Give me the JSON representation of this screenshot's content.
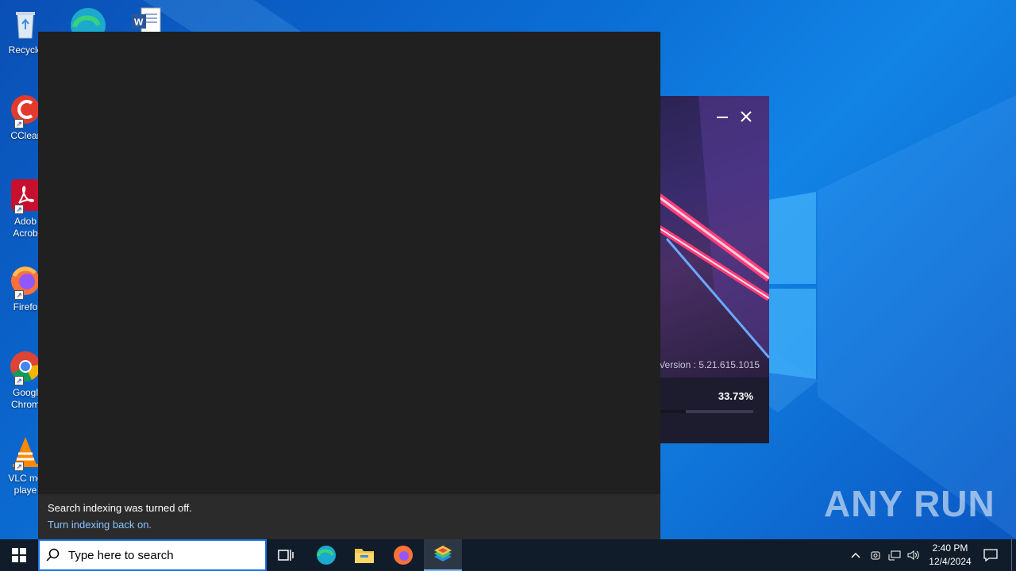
{
  "desktop": {
    "icons": [
      {
        "name": "recycle-bin",
        "label": "Recycle"
      },
      {
        "name": "ccleaner",
        "label": "CClear"
      },
      {
        "name": "adobe-acrobat",
        "label": "Adob\nAcrob"
      },
      {
        "name": "firefox",
        "label": "Firefo"
      },
      {
        "name": "google-chrome",
        "label": "Googl\nChrom"
      },
      {
        "name": "vlc-media-player",
        "label": "VLC me\nplaye"
      }
    ]
  },
  "installer": {
    "version": "Version : 5.21.615.1015",
    "progress_text": "33.73%",
    "progress": 0.3373,
    "minimize_icon": "minimize-icon",
    "close_icon": "close-icon"
  },
  "search_panel": {
    "footer_message": "Search indexing was turned off.",
    "footer_link": "Turn indexing back on."
  },
  "watermark": "ANY RUN",
  "taskbar": {
    "search_placeholder": "Type here to search",
    "apps": [
      "task-view",
      "microsoft-edge",
      "file-explorer",
      "firefox",
      "bluestacks"
    ],
    "clock_time": "2:40 PM",
    "clock_date": "12/4/2024"
  },
  "colors": {
    "accent": "#1a73e8",
    "link": "#8cc4ff",
    "panel": "#202020",
    "taskbar": "#101c2a"
  }
}
